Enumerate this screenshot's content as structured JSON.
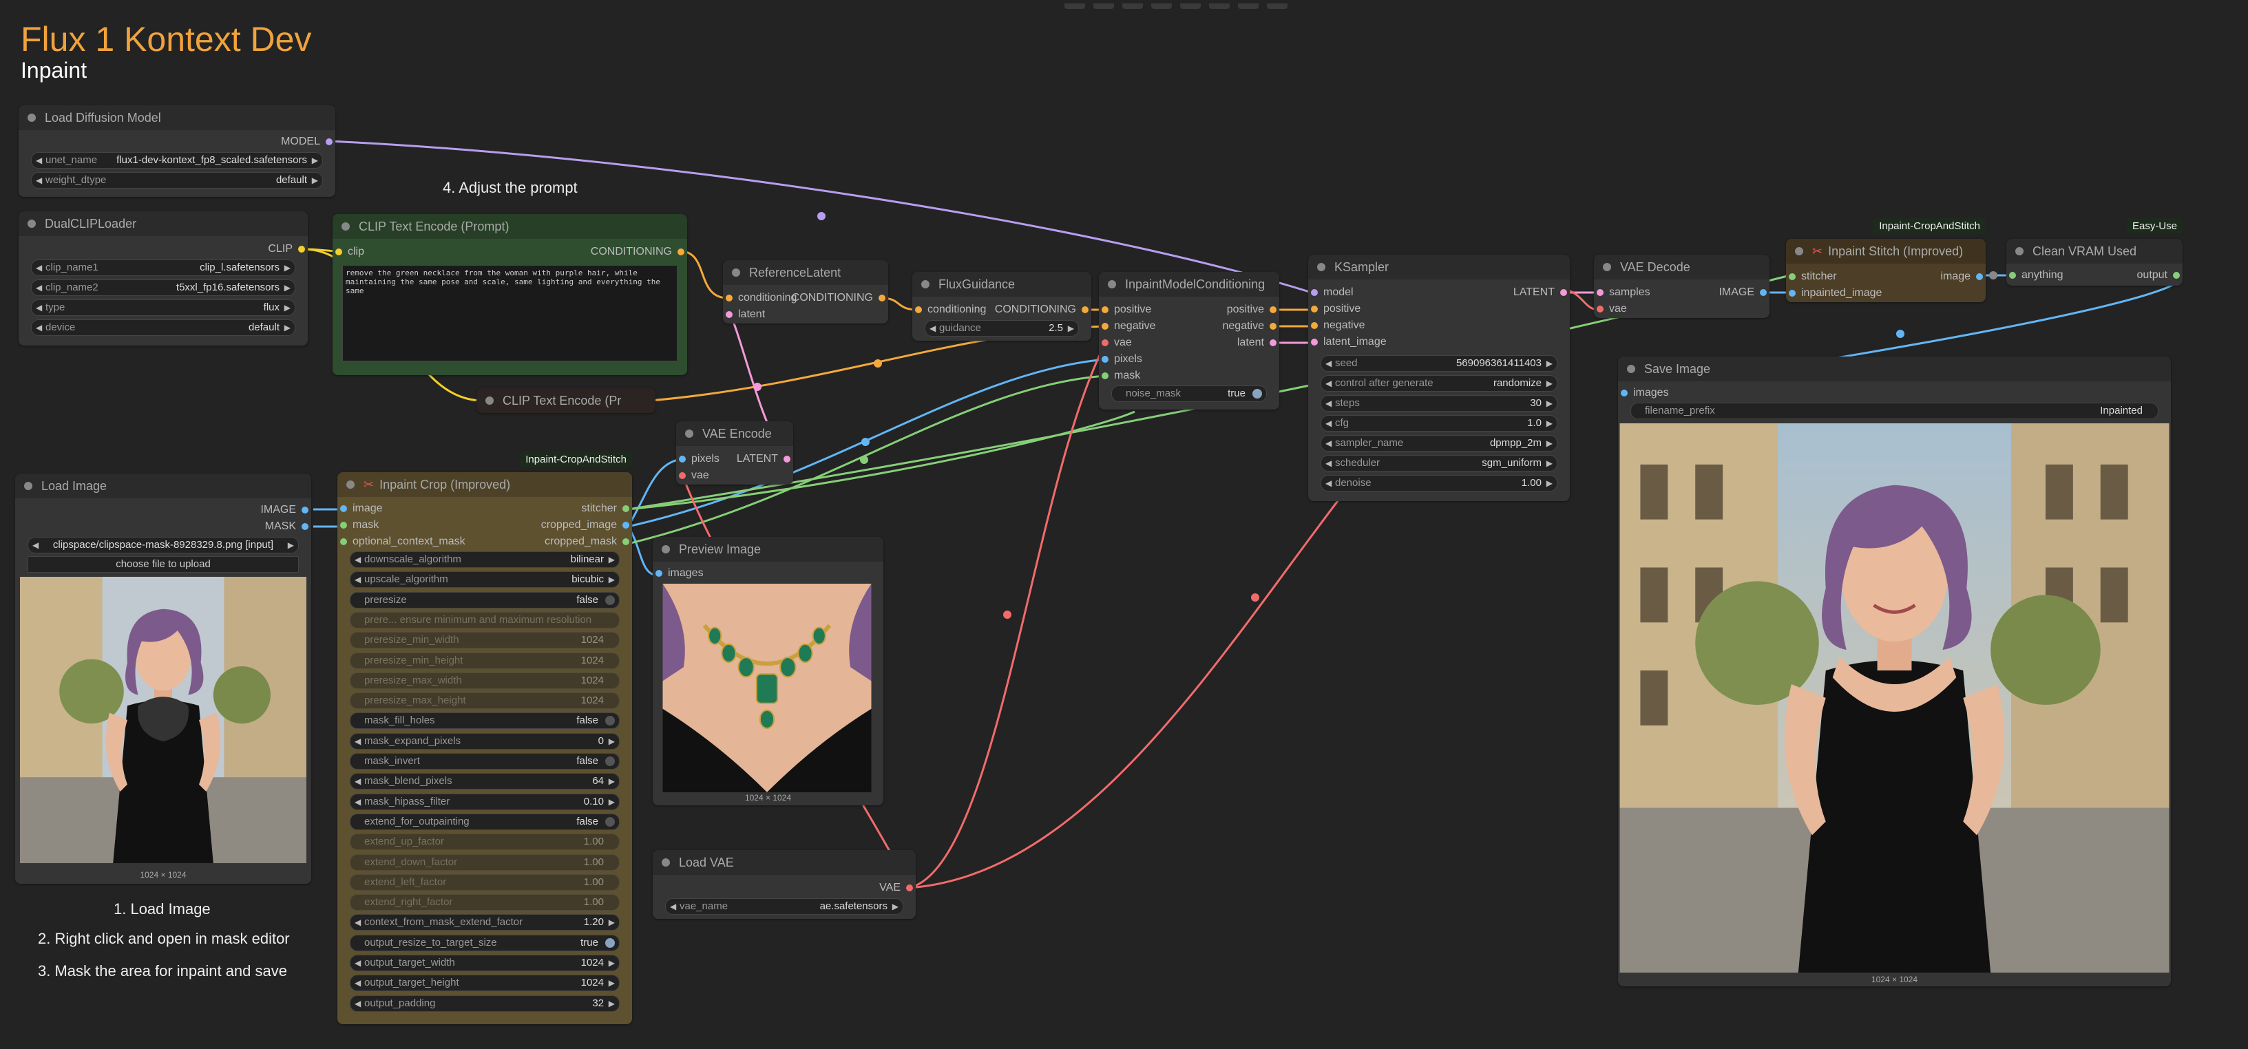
{
  "workflow": {
    "title": "Flux 1 Kontext Dev",
    "subtitle": "Inpaint"
  },
  "notes": {
    "adjust_prompt": "4. Adjust the prompt",
    "step1": "1. Load Image",
    "step2": "2. Right click and open in mask editor",
    "step3": "3. Mask the area for inpaint and save"
  },
  "colors": {
    "title": "#f0a33c",
    "clip_wire": "#f2d02b",
    "conditioning_wire": "#f4a93b",
    "image_wire": "#62b6f5",
    "mask_wire": "#86cf78",
    "vae_wire": "#f26b6b",
    "latent_wire": "#f49ad8",
    "model_wire": "#b79ef0"
  },
  "nodes": {
    "load_diffusion": {
      "title": "Load Diffusion Model",
      "out": "MODEL",
      "unet_label": "unet_name",
      "unet_value": "flux1-dev-kontext_fp8_scaled.safetensors",
      "dtype_label": "weight_dtype",
      "dtype_value": "default"
    },
    "dual_clip": {
      "title": "DualCLIPLoader",
      "out": "CLIP",
      "w1_label": "clip_name1",
      "w1_value": "clip_l.safetensors",
      "w2_label": "clip_name2",
      "w2_value": "t5xxl_fp16.safetensors",
      "w3_label": "type",
      "w3_value": "flux",
      "w4_label": "device",
      "w4_value": "default"
    },
    "clip_prompt": {
      "title": "CLIP Text Encode (Prompt)",
      "in": "clip",
      "out": "CONDITIONING",
      "text": "remove the green necklace from the woman with purple hair, while maintaining the same pose and scale, same lighting and everything the same"
    },
    "clip_neg": {
      "title": "CLIP Text Encode (Pr"
    },
    "ref_latent": {
      "title": "ReferenceLatent",
      "in1": "conditioning",
      "in2": "latent",
      "out": "CONDITIONING"
    },
    "flux_guidance": {
      "title": "FluxGuidance",
      "in": "conditioning",
      "out": "CONDITIONING",
      "w_label": "guidance",
      "w_value": "2.5"
    },
    "inpaint_cond": {
      "title": "InpaintModelConditioning",
      "in1": "positive",
      "in2": "negative",
      "in3": "vae",
      "in4": "pixels",
      "in5": "mask",
      "out1": "positive",
      "out2": "negative",
      "out3": "latent",
      "w_label": "noise_mask",
      "w_value": "true"
    },
    "ksampler": {
      "title": "KSampler",
      "in1": "model",
      "in2": "positive",
      "in3": "negative",
      "in4": "latent_image",
      "out": "LATENT",
      "widgets": [
        {
          "label": "seed",
          "value": "569096361411403"
        },
        {
          "label": "control after generate",
          "value": "randomize"
        },
        {
          "label": "steps",
          "value": "30"
        },
        {
          "label": "cfg",
          "value": "1.0"
        },
        {
          "label": "sampler_name",
          "value": "dpmpp_2m"
        },
        {
          "label": "scheduler",
          "value": "sgm_uniform"
        },
        {
          "label": "denoise",
          "value": "1.00"
        }
      ]
    },
    "vae_decode": {
      "title": "VAE Decode",
      "in1": "samples",
      "in2": "vae",
      "out": "IMAGE"
    },
    "inpaint_stitch": {
      "badge": "Inpaint-CropAndStitch",
      "title": "Inpaint Stitch (Improved)",
      "in1": "stitcher",
      "in2": "inpainted_image",
      "out": "image"
    },
    "clean_vram": {
      "badge": "Easy-Use",
      "title": "Clean VRAM Used",
      "in": "anything",
      "out": "output"
    },
    "save_image": {
      "title": "Save Image",
      "in": "images",
      "w_label": "filename_prefix",
      "w_value": "Inpainted",
      "caption": "1024 × 1024"
    },
    "load_image": {
      "title": "Load Image",
      "out1": "IMAGE",
      "out2": "MASK",
      "file": "clipspace/clipspace-mask-8928329.8.png [input]",
      "upload": "choose file to upload",
      "caption": "1024 × 1024"
    },
    "inpaint_crop": {
      "badge": "Inpaint-CropAndStitch",
      "title": "Inpaint Crop (Improved)",
      "in1": "image",
      "in2": "mask",
      "in3": "optional_context_mask",
      "out1": "stitcher",
      "out2": "cropped_image",
      "out3": "cropped_mask",
      "widgets": [
        {
          "label": "downscale_algorithm",
          "value": "bilinear",
          "kind": "combo"
        },
        {
          "label": "upscale_algorithm",
          "value": "bicubic",
          "kind": "combo"
        },
        {
          "label": "preresize",
          "value": "false",
          "kind": "toggle"
        },
        {
          "label": "prere... ensure minimum and maximum resolution",
          "value": "",
          "kind": "disabled"
        },
        {
          "label": "preresize_min_width",
          "value": "1024",
          "kind": "disabled"
        },
        {
          "label": "preresize_min_height",
          "value": "1024",
          "kind": "disabled"
        },
        {
          "label": "preresize_max_width",
          "value": "1024",
          "kind": "disabled"
        },
        {
          "label": "preresize_max_height",
          "value": "1024",
          "kind": "disabled"
        },
        {
          "label": "mask_fill_holes",
          "value": "false",
          "kind": "toggle"
        },
        {
          "label": "mask_expand_pixels",
          "value": "0",
          "kind": "combo"
        },
        {
          "label": "mask_invert",
          "value": "false",
          "kind": "toggle"
        },
        {
          "label": "mask_blend_pixels",
          "value": "64",
          "kind": "combo"
        },
        {
          "label": "mask_hipass_filter",
          "value": "0.10",
          "kind": "combo"
        },
        {
          "label": "extend_for_outpainting",
          "value": "false",
          "kind": "toggle"
        },
        {
          "label": "extend_up_factor",
          "value": "1.00",
          "kind": "disabled"
        },
        {
          "label": "extend_down_factor",
          "value": "1.00",
          "kind": "disabled"
        },
        {
          "label": "extend_left_factor",
          "value": "1.00",
          "kind": "disabled"
        },
        {
          "label": "extend_right_factor",
          "value": "1.00",
          "kind": "disabled"
        },
        {
          "label": "context_from_mask_extend_factor",
          "value": "1.20",
          "kind": "combo"
        },
        {
          "label": "output_resize_to_target_size",
          "value": "true",
          "kind": "toggle-on"
        },
        {
          "label": "output_target_width",
          "value": "1024",
          "kind": "combo"
        },
        {
          "label": "output_target_height",
          "value": "1024",
          "kind": "combo"
        },
        {
          "label": "output_padding",
          "value": "32",
          "kind": "combo"
        }
      ]
    },
    "vae_encode": {
      "title": "VAE Encode",
      "in1": "pixels",
      "in2": "vae",
      "out": "LATENT"
    },
    "preview_image": {
      "title": "Preview Image",
      "in": "images",
      "caption": "1024 × 1024"
    },
    "load_vae": {
      "title": "Load VAE",
      "out": "VAE",
      "w_label": "vae_name",
      "w_value": "ae.safetensors"
    }
  }
}
